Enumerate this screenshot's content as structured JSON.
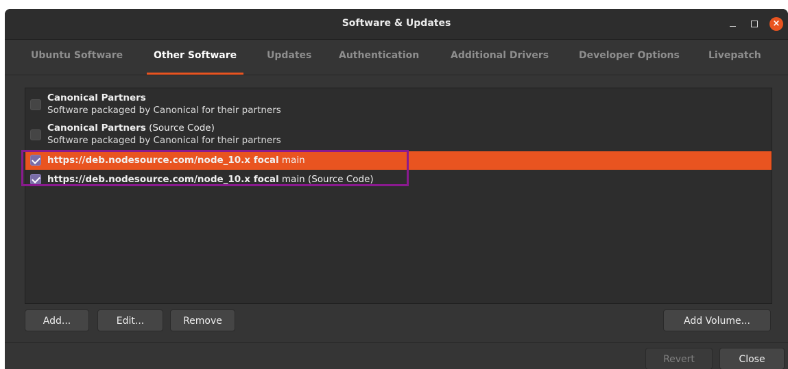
{
  "window": {
    "title": "Software & Updates"
  },
  "window_controls": {
    "close_glyph": "×"
  },
  "tabs": [
    {
      "label": "Ubuntu Software"
    },
    {
      "label": "Other Software",
      "active": true
    },
    {
      "label": "Updates"
    },
    {
      "label": "Authentication"
    },
    {
      "label": "Additional Drivers"
    },
    {
      "label": "Developer Options"
    },
    {
      "label": "Livepatch"
    }
  ],
  "sources": [
    {
      "title_bold": "Canonical Partners",
      "title_rest": "",
      "subtitle": "Software packaged by Canonical for their partners",
      "checked": false
    },
    {
      "title_bold": "Canonical Partners",
      "title_rest": " (Source Code)",
      "subtitle": "Software packaged by Canonical for their partners",
      "checked": false
    },
    {
      "title_bold": "https://deb.nodesource.com/node_10.x focal",
      "title_rest": " main",
      "checked": true,
      "selected": true
    },
    {
      "title_bold": "https://deb.nodesource.com/node_10.x focal",
      "title_rest": " main (Source Code)",
      "checked": true,
      "selected": false
    }
  ],
  "buttons": {
    "add": "Add...",
    "edit": "Edit...",
    "remove": "Remove",
    "add_volume": "Add Volume...",
    "revert": "Revert",
    "close": "Close"
  },
  "colors": {
    "accent": "#e95420",
    "highlight_border": "#8a1a8f",
    "checkbox_checked": "#7a6da8"
  },
  "icons": [
    "minimize-icon",
    "maximize-icon",
    "close-icon",
    "checkbox-icon"
  ]
}
